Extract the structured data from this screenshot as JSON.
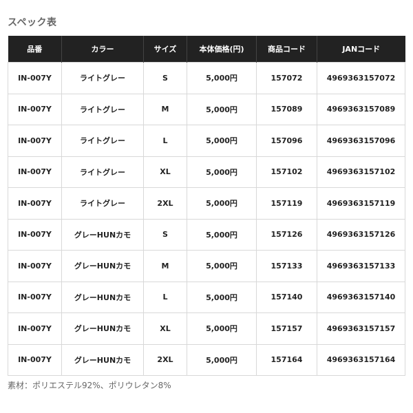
{
  "title": "スペック表",
  "table": {
    "headers": [
      "品番",
      "カラー",
      "サイズ",
      "本体価格(円)",
      "商品コード",
      "JANコード"
    ],
    "rows": [
      [
        "IN-007Y",
        "ライトグレー",
        "S",
        "5,000円",
        "157072",
        "4969363157072"
      ],
      [
        "IN-007Y",
        "ライトグレー",
        "M",
        "5,000円",
        "157089",
        "4969363157089"
      ],
      [
        "IN-007Y",
        "ライトグレー",
        "L",
        "5,000円",
        "157096",
        "4969363157096"
      ],
      [
        "IN-007Y",
        "ライトグレー",
        "XL",
        "5,000円",
        "157102",
        "4969363157102"
      ],
      [
        "IN-007Y",
        "ライトグレー",
        "2XL",
        "5,000円",
        "157119",
        "4969363157119"
      ],
      [
        "IN-007Y",
        "グレーHUNカモ",
        "S",
        "5,000円",
        "157126",
        "4969363157126"
      ],
      [
        "IN-007Y",
        "グレーHUNカモ",
        "M",
        "5,000円",
        "157133",
        "4969363157133"
      ],
      [
        "IN-007Y",
        "グレーHUNカモ",
        "L",
        "5,000円",
        "157140",
        "4969363157140"
      ],
      [
        "IN-007Y",
        "グレーHUNカモ",
        "XL",
        "5,000円",
        "157157",
        "4969363157157"
      ],
      [
        "IN-007Y",
        "グレーHUNカモ",
        "2XL",
        "5,000円",
        "157164",
        "4969363157164"
      ]
    ]
  },
  "material": "素材：ポリエステル92%、ポリウレタン8%",
  "colors": {
    "header_bg": "#222222",
    "header_text": "#ffffff",
    "border": "#d8d8d8",
    "title_text": "#666666"
  }
}
